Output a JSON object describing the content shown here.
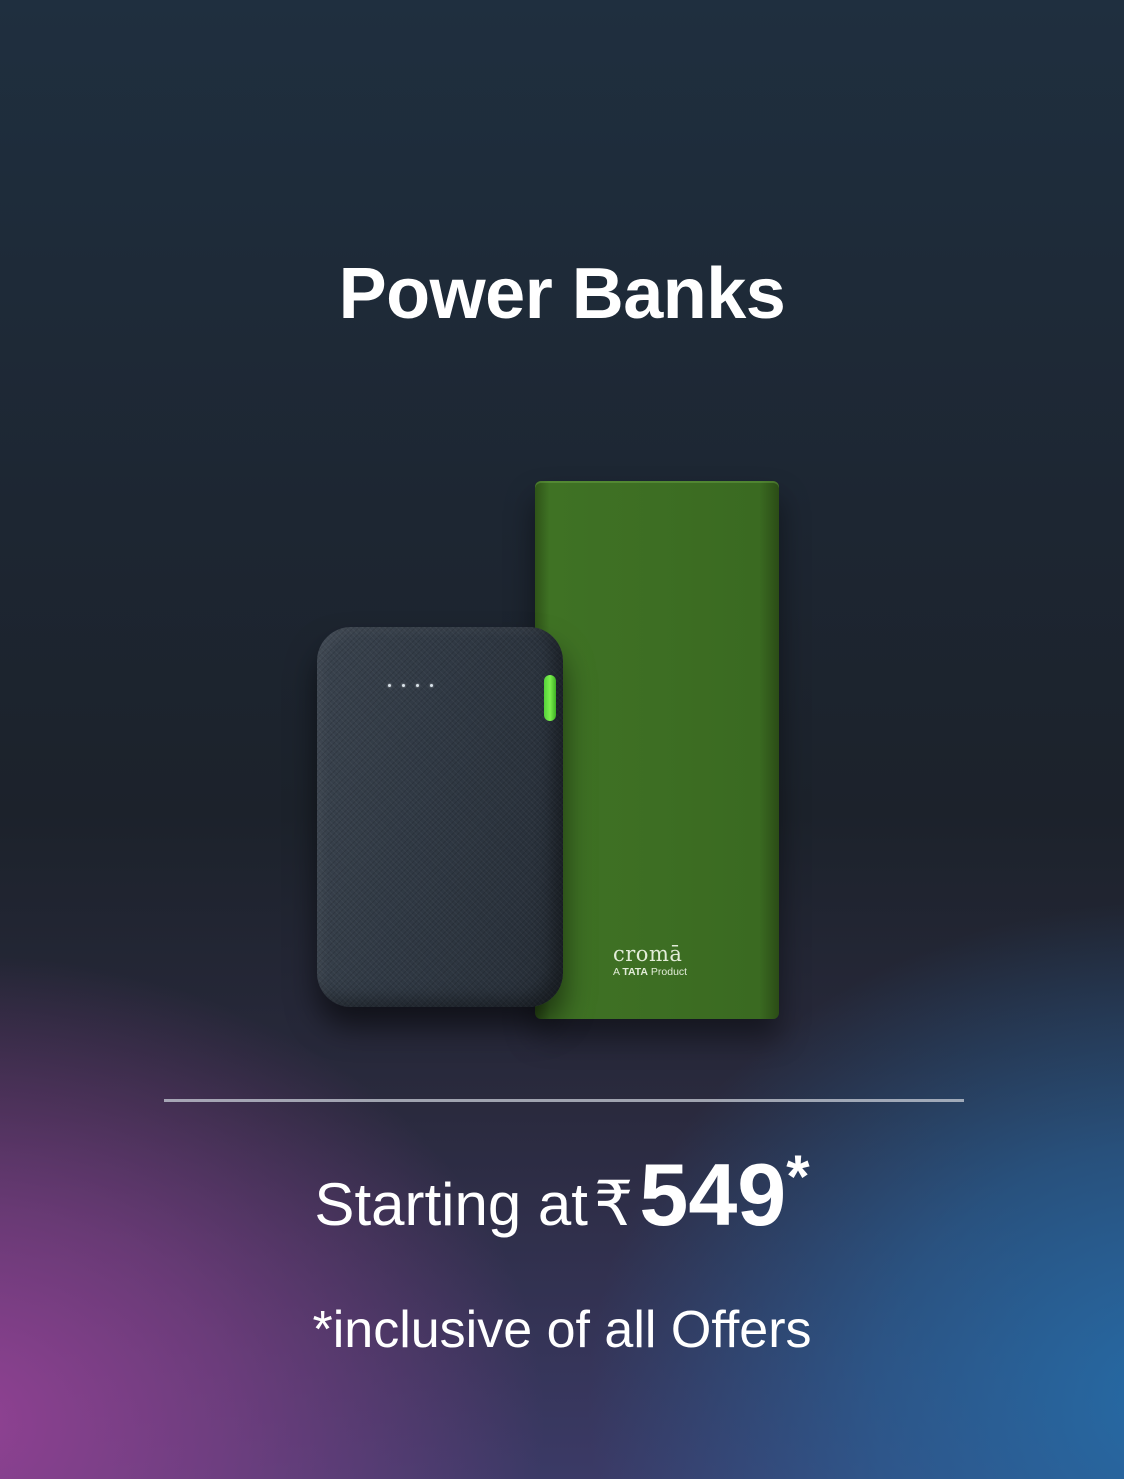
{
  "banner": {
    "title": "Power Banks",
    "price": {
      "prefix": "Starting at",
      "currency_symbol": "₹",
      "amount": "549",
      "suffix": "*"
    },
    "disclaimer": "*inclusive of all Offers"
  },
  "products": {
    "green_power_bank": {
      "brand": "cromā",
      "tagline_prefix": "A ",
      "tagline_bold": "TATA",
      "tagline_suffix": " Product",
      "color": "#3d6e23"
    },
    "fabric_power_bank": {
      "led_count": 4,
      "button_color": "#6be246"
    }
  },
  "colors": {
    "text": "#ffffff",
    "gradient_pink": "#964296",
    "gradient_blue": "#246eaa"
  }
}
